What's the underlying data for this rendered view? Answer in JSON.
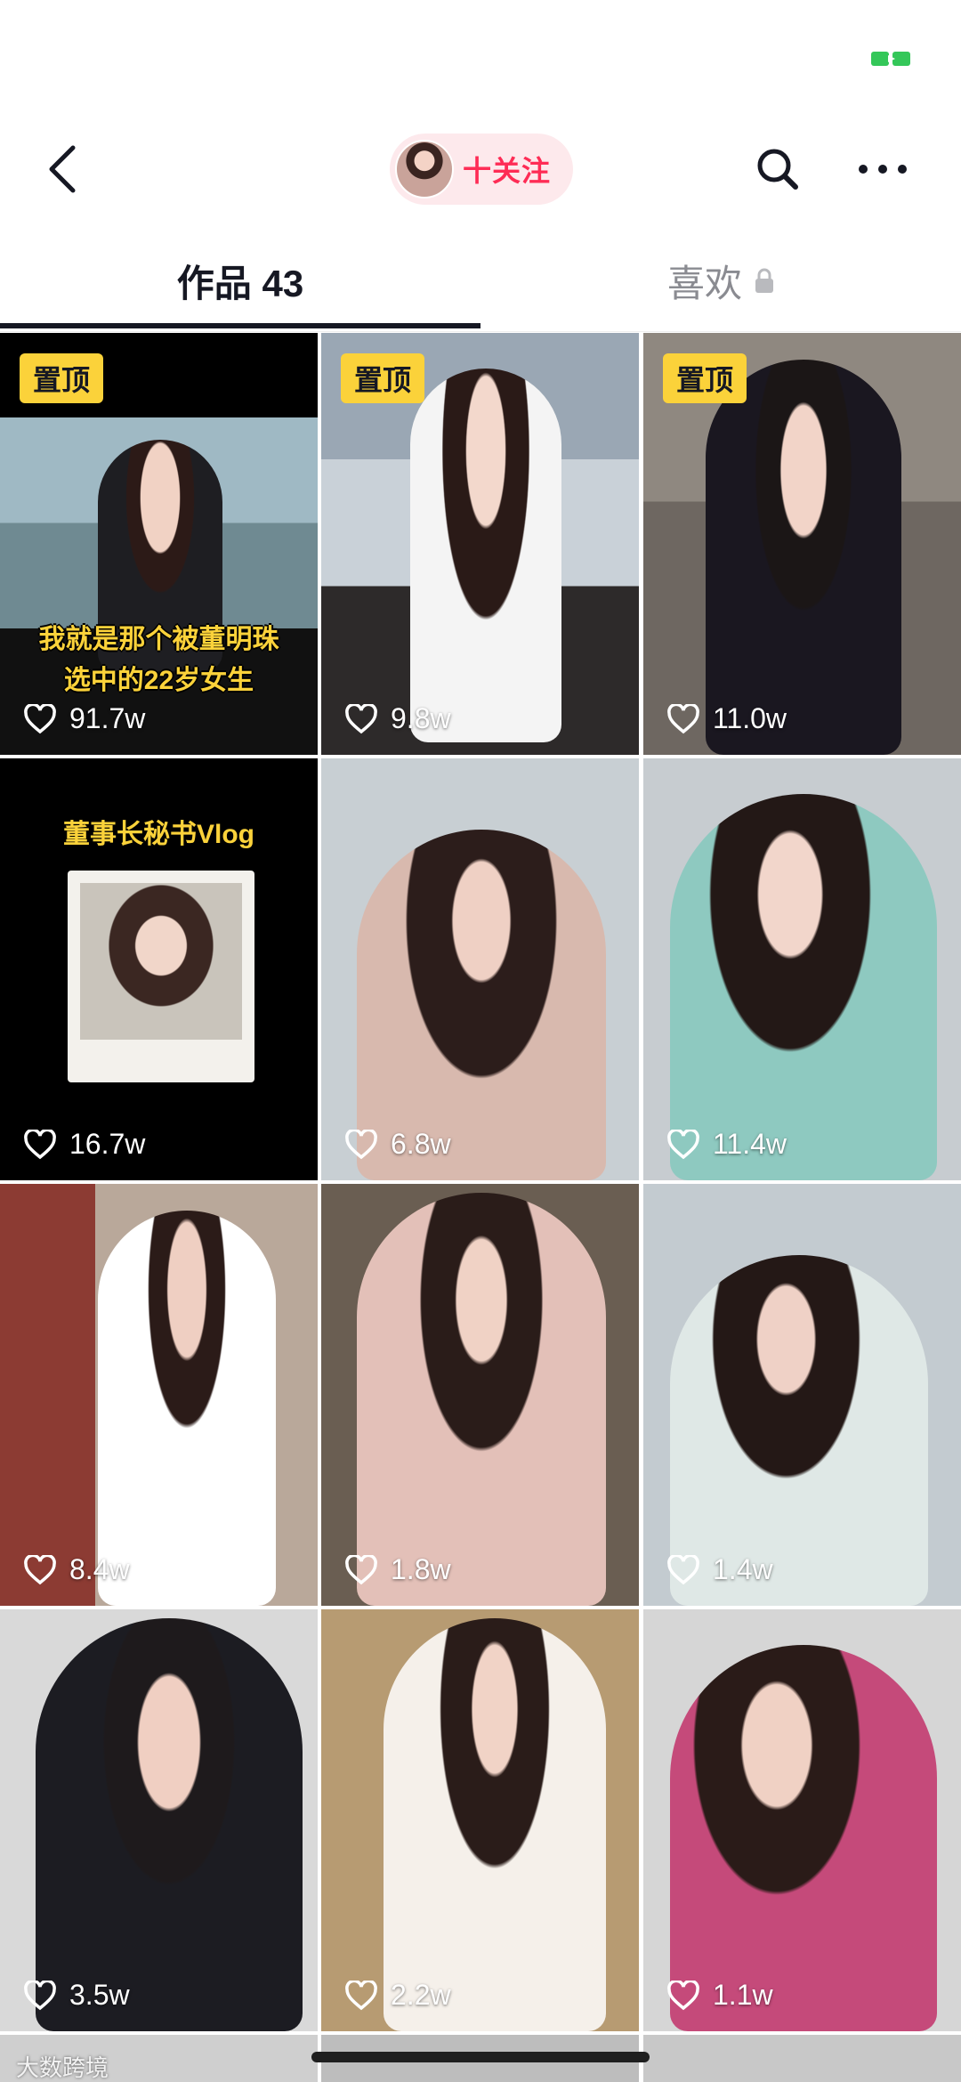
{
  "nav": {
    "follow_label": "十关注"
  },
  "tabs": {
    "works_label": "作品 43",
    "likes_label": "喜欢"
  },
  "videos": [
    {
      "pinned": "置顶",
      "likes": "91.7w",
      "caption_line1": "我就是那个被董明珠",
      "caption_line2": "选中的22岁女生"
    },
    {
      "pinned": "置顶",
      "likes": "9.8w"
    },
    {
      "pinned": "置顶",
      "likes": "11.0w"
    },
    {
      "likes": "16.7w",
      "caption": "董事长秘书Vlog"
    },
    {
      "likes": "6.8w"
    },
    {
      "likes": "11.4w"
    },
    {
      "likes": "8.4w"
    },
    {
      "likes": "1.8w"
    },
    {
      "likes": "1.4w"
    },
    {
      "likes": "3.5w"
    },
    {
      "likes": "2.2w"
    },
    {
      "likes": "1.1w"
    }
  ],
  "watermark": "大数跨境",
  "colors": {
    "accent": "#fe2c55",
    "pin_badge": "#fbd23a",
    "tab_active": "#161823",
    "tab_inactive": "#8a8b91"
  },
  "icons": [
    "back-arrow-icon",
    "search-icon",
    "more-icon",
    "lock-icon",
    "heart-icon",
    "battery-icon"
  ]
}
